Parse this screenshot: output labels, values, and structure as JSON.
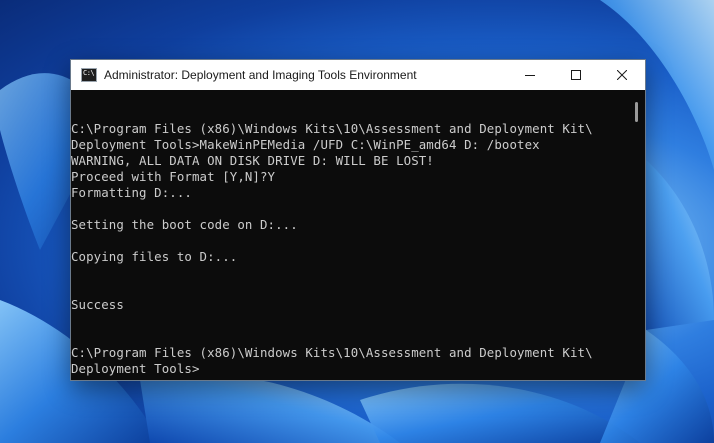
{
  "window": {
    "title": "Administrator: Deployment and Imaging Tools Environment",
    "app_icon_text": "C:\\",
    "icons": {
      "app": "console-icon",
      "minimize": "minimize-icon",
      "maximize": "maximize-icon",
      "close": "close-icon"
    }
  },
  "console": {
    "lines": [
      "C:\\Program Files (x86)\\Windows Kits\\10\\Assessment and Deployment Kit\\",
      "Deployment Tools>MakeWinPEMedia /UFD C:\\WinPE_amd64 D: /bootex",
      "WARNING, ALL DATA ON DISK DRIVE D: WILL BE LOST!",
      "Proceed with Format [Y,N]?Y",
      "Formatting D:...",
      "",
      "Setting the boot code on D:...",
      "",
      "Copying files to D:...",
      "",
      "",
      "Success",
      "",
      "",
      "C:\\Program Files (x86)\\Windows Kits\\10\\Assessment and Deployment Kit\\",
      "Deployment Tools>"
    ]
  },
  "colors": {
    "console_bg": "#0c0c0c",
    "console_text": "#cccccc",
    "titlebar_bg": "#ffffff"
  }
}
